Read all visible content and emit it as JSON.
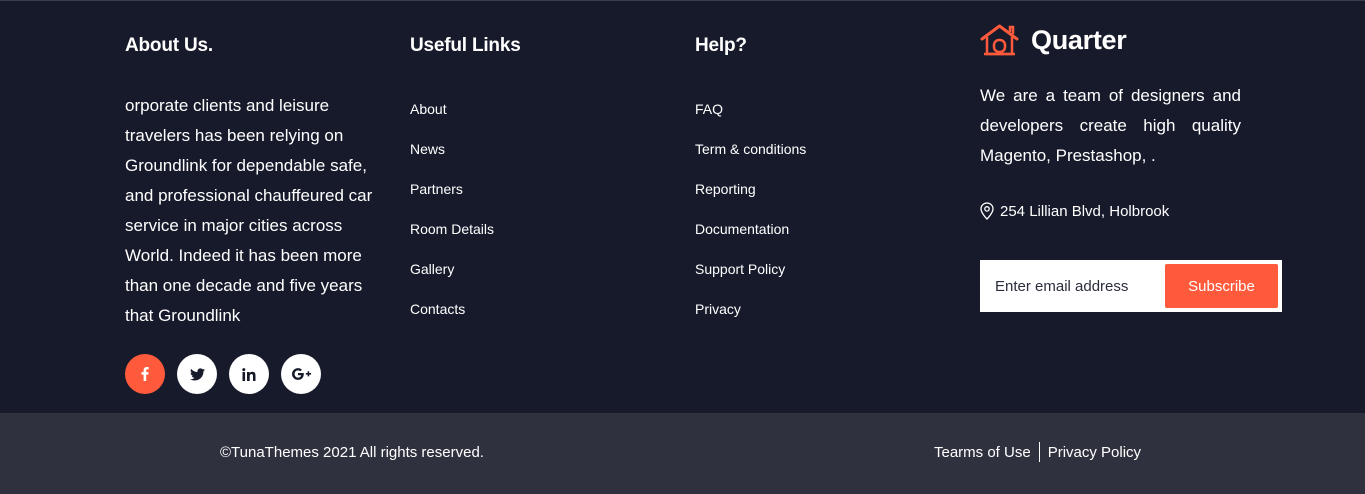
{
  "colors": {
    "background": "#171a2b",
    "bottom_bar": "#2f323e",
    "accent": "#ff5a3c",
    "text": "#ffffff"
  },
  "about": {
    "title": "About Us.",
    "text": "orporate clients and leisure travelers has been relying on Groundlink for dependable safe, and professional chauffeured car service in major cities across World. Indeed it has been more than one decade and five years that Groundlink",
    "social": [
      {
        "name": "facebook-icon",
        "glyph": "f"
      },
      {
        "name": "twitter-icon",
        "glyph": "twitter"
      },
      {
        "name": "linkedin-icon",
        "glyph": "in"
      },
      {
        "name": "google-plus-icon",
        "glyph": "G+"
      }
    ]
  },
  "useful_links": {
    "title": "Useful Links",
    "items": [
      "About",
      "News",
      "Partners",
      "Room Details",
      "Gallery",
      "Contacts"
    ]
  },
  "help": {
    "title": "Help?",
    "items": [
      "FAQ",
      "Term & conditions",
      "Reporting",
      "Documentation",
      "Support Policy",
      "Privacy"
    ]
  },
  "brand": {
    "name": "Quarter",
    "logo_icon": "house-icon",
    "description": "We are a team of designers and developers create high quality Magento, Prestashop, .",
    "address": "254 Lillian Blvd, Holbrook",
    "email_placeholder": "Enter email address",
    "subscribe_label": "Subscribe"
  },
  "bottom": {
    "copyright": "©TunaThemes 2021 All rights reserved.",
    "terms": "Tearms of Use",
    "privacy": "Privacy Policy"
  }
}
